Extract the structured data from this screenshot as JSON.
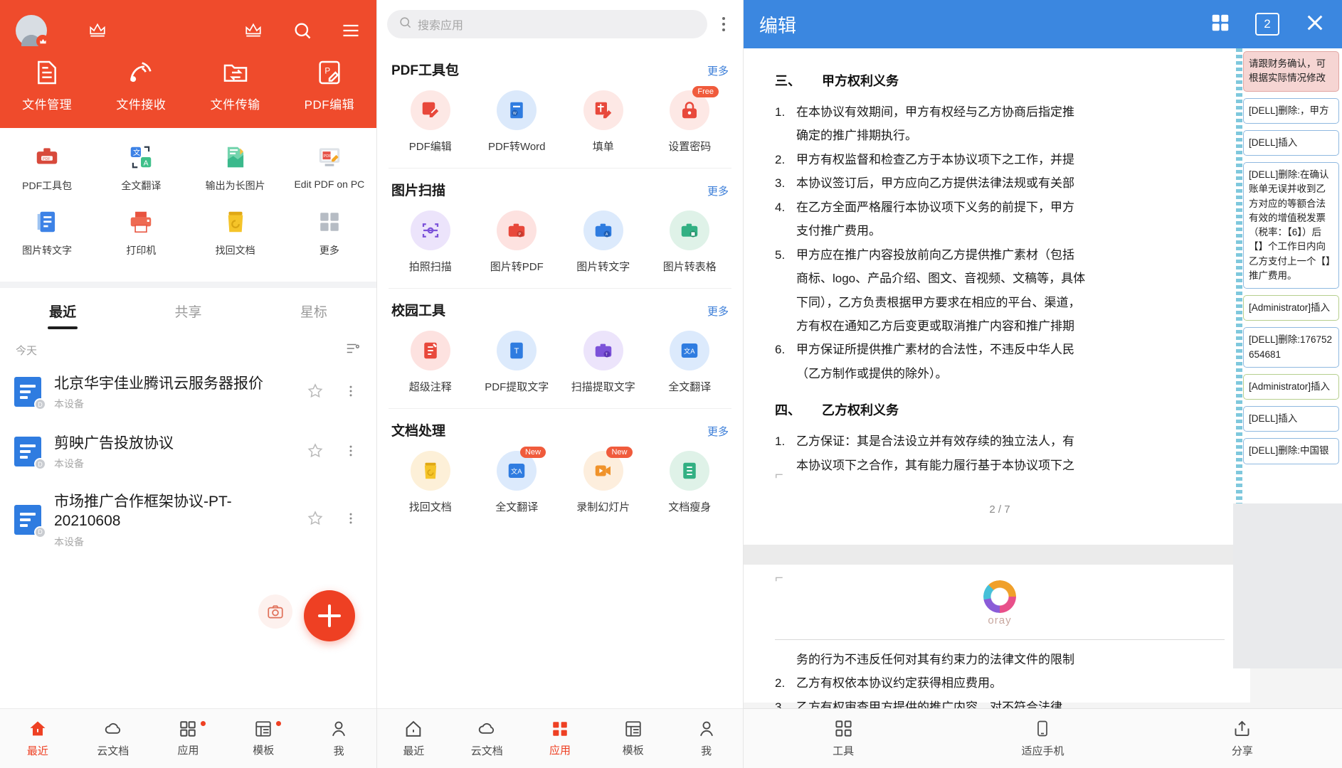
{
  "left_panel": {
    "hero": {
      "avatar_name": "user-avatar",
      "vip_icon": "crown-icon",
      "crown_icon": "crown-icon",
      "search_icon": "search-icon",
      "menu_icon": "hamburger-menu-icon",
      "quick_items": [
        {
          "label": "文件管理",
          "icon": "file-manage-icon"
        },
        {
          "label": "文件接收",
          "icon": "file-receive-icon"
        },
        {
          "label": "文件传输",
          "icon": "file-transfer-icon"
        },
        {
          "label": "PDF编辑",
          "icon": "pdf-edit-icon"
        }
      ]
    },
    "tools": [
      [
        {
          "label": "PDF工具包",
          "icon": "pdf-toolkit-icon"
        },
        {
          "label": "全文翻译",
          "icon": "translate-icon"
        },
        {
          "label": "输出为长图片",
          "icon": "export-long-image-icon"
        },
        {
          "label": "Edit PDF on PC",
          "icon": "edit-pdf-on-pc-icon"
        }
      ],
      [
        {
          "label": "图片转文字",
          "icon": "image-to-text-icon"
        },
        {
          "label": "打印机",
          "icon": "printer-icon"
        },
        {
          "label": "找回文档",
          "icon": "recover-document-icon"
        },
        {
          "label": "更多",
          "icon": "more-grid-icon"
        }
      ]
    ],
    "tabs": [
      {
        "label": "最近",
        "active": true
      },
      {
        "label": "共享",
        "active": false
      },
      {
        "label": "星标",
        "active": false
      }
    ],
    "group_label": "今天",
    "filter_icon": "filter-icon",
    "files": [
      {
        "name": "北京华宇佳业腾讯云服务器报价",
        "location": "本设备"
      },
      {
        "name": "剪映广告投放协议",
        "location": "本设备"
      },
      {
        "name": "市场推广合作框架协议-PT-20210608",
        "location": "本设备"
      }
    ],
    "fab_camera_icon": "camera-icon",
    "fab_add_icon": "plus-icon",
    "bottom_nav": [
      {
        "label": "最近",
        "icon": "home-icon",
        "active": true,
        "dot": false
      },
      {
        "label": "云文档",
        "icon": "cloud-icon",
        "active": false,
        "dot": false
      },
      {
        "label": "应用",
        "icon": "apps-grid-icon",
        "active": false,
        "dot": true
      },
      {
        "label": "模板",
        "icon": "template-icon",
        "active": false,
        "dot": true
      },
      {
        "label": "我",
        "icon": "person-icon",
        "active": false,
        "dot": false
      }
    ]
  },
  "mid_panel": {
    "search": {
      "placeholder": "搜索应用",
      "icon": "search-icon"
    },
    "kebab_icon": "more-vertical-icon",
    "more_label": "更多",
    "sections": [
      {
        "title": "PDF工具包",
        "more": "更多",
        "items": [
          {
            "label": "PDF编辑",
            "icon": "pdf-edit-icon",
            "bg": "#fde8e5",
            "badge": ""
          },
          {
            "label": "PDF转Word",
            "icon": "pdf-to-word-icon",
            "bg": "#dbe9fb",
            "badge": ""
          },
          {
            "label": "填单",
            "icon": "fill-form-icon",
            "bg": "#fde8e5",
            "badge": ""
          },
          {
            "label": "设置密码",
            "icon": "set-password-icon",
            "bg": "#fde8e5",
            "badge": "Free"
          }
        ]
      },
      {
        "title": "图片扫描",
        "more": "更多",
        "items": [
          {
            "label": "拍照扫描",
            "icon": "photo-scan-icon",
            "bg": "#ece4fb",
            "badge": ""
          },
          {
            "label": "图片转PDF",
            "icon": "image-to-pdf-icon",
            "bg": "#fde2e0",
            "badge": ""
          },
          {
            "label": "图片转文字",
            "icon": "image-to-text-icon",
            "bg": "#dceafc",
            "badge": ""
          },
          {
            "label": "图片转表格",
            "icon": "image-to-table-icon",
            "bg": "#dff2e8",
            "badge": ""
          }
        ]
      },
      {
        "title": "校园工具",
        "more": "更多",
        "items": [
          {
            "label": "超级注释",
            "icon": "super-annotate-icon",
            "bg": "#fde2e0",
            "badge": ""
          },
          {
            "label": "PDF提取文字",
            "icon": "pdf-extract-text-icon",
            "bg": "#dceafc",
            "badge": ""
          },
          {
            "label": "扫描提取文字",
            "icon": "scan-extract-text-icon",
            "bg": "#ece4fb",
            "badge": ""
          },
          {
            "label": "全文翻译",
            "icon": "translate-icon",
            "bg": "#dceafc",
            "badge": ""
          }
        ]
      },
      {
        "title": "文档处理",
        "more": "更多",
        "items": [
          {
            "label": "找回文档",
            "icon": "recover-document-icon",
            "bg": "#fdf0d8",
            "badge": ""
          },
          {
            "label": "全文翻译",
            "icon": "translate-icon",
            "bg": "#dceafc",
            "badge": "New"
          },
          {
            "label": "录制幻灯片",
            "icon": "record-slides-icon",
            "bg": "#fdeedd",
            "badge": "New"
          },
          {
            "label": "文档瘦身",
            "icon": "document-slim-icon",
            "bg": "#dff2e8",
            "badge": ""
          }
        ]
      }
    ],
    "bottom_nav": [
      {
        "label": "最近",
        "icon": "home-icon",
        "active": false,
        "dot": false
      },
      {
        "label": "云文档",
        "icon": "cloud-icon",
        "active": false,
        "dot": false
      },
      {
        "label": "应用",
        "icon": "apps-grid-icon",
        "active": true,
        "dot": false
      },
      {
        "label": "模板",
        "icon": "template-icon",
        "active": false,
        "dot": false
      },
      {
        "label": "我",
        "icon": "person-icon",
        "active": false,
        "dot": false
      }
    ]
  },
  "right_panel": {
    "title": "编辑",
    "grid_icon": "grid-view-icon",
    "page_indicator": "2",
    "close_icon": "close-icon",
    "document": {
      "heading1_num": "三、",
      "heading1_text": "甲方权利义务",
      "list1": [
        {
          "num": "1.",
          "text": "在本协议有效期间，甲方有权经与乙方协商后指定推"
        },
        {
          "num": "",
          "text": "确定的推广排期执行。"
        },
        {
          "num": "2.",
          "text": "甲方有权监督和检查乙方于本协议项下之工作，并提"
        },
        {
          "num": "3.",
          "text": "本协议签订后，甲方应向乙方提供法律法规或有关部"
        },
        {
          "num": "4.",
          "text": "在乙方全面严格履行本协议项下义务的前提下，甲方"
        },
        {
          "num": "",
          "text": "支付推广费用。"
        },
        {
          "num": "5.",
          "text": "甲方应在推广内容投放前向乙方提供推广素材（包括"
        },
        {
          "num": "",
          "text": "商标、logo、产品介绍、图文、音视频、文稿等，具体"
        },
        {
          "num": "",
          "text": "下同），乙方负责根据甲方要求在相应的平台、渠道，"
        },
        {
          "num": "",
          "text": "方有权在通知乙方后变更或取消推广内容和推广排期"
        },
        {
          "num": "6.",
          "text": "甲方保证所提供推广素材的合法性，不违反中华人民"
        },
        {
          "num": "",
          "text": "（乙方制作或提供的除外）。"
        }
      ],
      "heading2_num": "四、",
      "heading2_text": "乙方权利义务",
      "list2": [
        {
          "num": "1.",
          "text": "乙方保证：其是合法设立并有效存续的独立法人，有"
        },
        {
          "num": "",
          "text": "本协议项下之合作，其有能力履行基于本协议项下之"
        }
      ],
      "page_number": "2 / 7",
      "watermark": "oray",
      "footer_lines": [
        {
          "num": "",
          "text": "务的行为不违反任何对其有约束力的法律文件的限制"
        },
        {
          "num": "2.",
          "text": "乙方有权依本协议约定获得相应费用。"
        },
        {
          "num": "3.",
          "text": "乙方有权审查甲方提供的推广内容，对不符合法律、"
        }
      ]
    },
    "revisions": [
      {
        "text": "请跟财务确认，可根据实际情况修改",
        "type": "comment"
      },
      {
        "text": "[DELL]删除:，甲方",
        "type": "delete"
      },
      {
        "text": "[DELL]插入",
        "type": "insert"
      },
      {
        "text": "[DELL]删除:在确认账单无误并收到乙方对应的等额合法有效的增值税发票（税率：【6】）后【】个工作日内向乙方支付上一个【】推广费用。",
        "type": "delete"
      },
      {
        "text": "[Administrator]插入",
        "type": "admin"
      },
      {
        "text": "[DELL]删除:176752654681",
        "type": "delete"
      },
      {
        "text": "[Administrator]插入",
        "type": "admin"
      },
      {
        "text": "[DELL]插入",
        "type": "insert"
      },
      {
        "text": "[DELL]删除:中国银",
        "type": "delete"
      }
    ],
    "bottom_nav": [
      {
        "label": "工具",
        "icon": "tools-icon"
      },
      {
        "label": "适应手机",
        "icon": "fit-phone-icon"
      },
      {
        "label": "分享",
        "icon": "share-icon"
      }
    ]
  },
  "colors": {
    "brand_red": "#ee4023",
    "hero_red": "#ef4b2c",
    "editor_blue": "#3b87e0",
    "link_blue": "#3a7dd8"
  }
}
